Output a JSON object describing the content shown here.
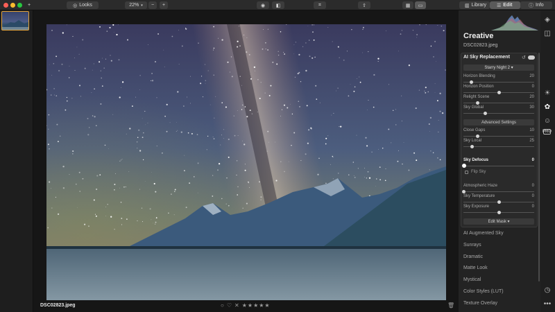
{
  "toolbar": {
    "looks_label": "Looks",
    "zoom_value": "22%",
    "zoom_minus": "−",
    "zoom_plus": "+",
    "add_label": "+",
    "tabs": [
      {
        "label": "Library",
        "active": false
      },
      {
        "label": "Edit",
        "active": true
      },
      {
        "label": "Info",
        "active": false
      }
    ]
  },
  "canvas": {
    "filename": "DSC02823.jpeg",
    "rating_stars": "★★★★★",
    "reject_symbol": "✕",
    "flag_symbol": "○",
    "heart_symbol": "♡",
    "trash_icon": "🗑"
  },
  "panel": {
    "title": "Creative",
    "subtitle": "DSC02823.jpeg",
    "card_title": "AI Sky Replacement",
    "sky_preset": "Starry Night 2 ▾",
    "sliders_top": [
      {
        "label": "Horizon Blending",
        "value": "20",
        "level": 0.11
      },
      {
        "label": "Horizon Position",
        "value": "0",
        "level": 0.5
      },
      {
        "label": "Relight Scene",
        "value": "20",
        "level": 0.2
      },
      {
        "label": "Sky Global",
        "value": "30",
        "level": 0.3
      }
    ],
    "advanced_label": "Advanced Settings",
    "sliders_adv": [
      {
        "label": "Close Gaps",
        "value": "10",
        "level": 0.2
      },
      {
        "label": "Sky Local",
        "value": "25",
        "level": 0.12
      }
    ],
    "defocus": {
      "label": "Sky Defocus",
      "value": "0",
      "level": 0.0
    },
    "flip_label": "Flip Sky",
    "sliders_bottom": [
      {
        "label": "Atmospheric Haze",
        "value": "0",
        "level": 0.0
      },
      {
        "label": "Sky Temperature",
        "value": "0",
        "level": 0.5
      },
      {
        "label": "Sky Exposure",
        "value": "0",
        "level": 0.5
      }
    ],
    "edit_mask_label": "Edit Mask ▾",
    "list": [
      "AI Augmented Sky",
      "Sunrays",
      "Dramatic",
      "Matte Look",
      "Mystical",
      "Color Styles (LUT)",
      "Texture Overlay"
    ]
  },
  "colors": {
    "accent": "#e2a33a",
    "panel_bg": "#232323"
  }
}
